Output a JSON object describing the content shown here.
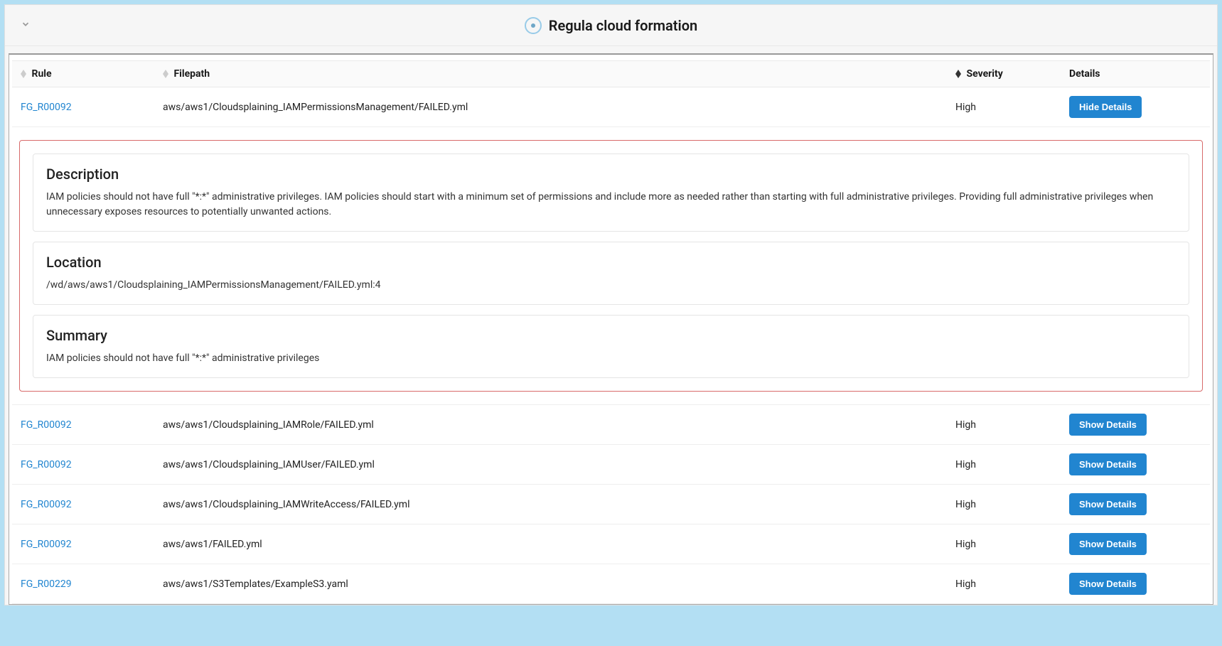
{
  "header": {
    "title": "Regula cloud formation"
  },
  "table": {
    "columns": {
      "rule": "Rule",
      "filepath": "Filepath",
      "severity": "Severity",
      "details": "Details"
    },
    "buttons": {
      "show": "Show Details",
      "hide": "Hide Details"
    },
    "rows": [
      {
        "rule": "FG_R00092",
        "filepath": "aws/aws1/Cloudsplaining_IAMPermissionsManagement/FAILED.yml",
        "severity": "High",
        "expanded": true,
        "details": {
          "description_title": "Description",
          "description_text": "IAM policies should not have full \"*:*\" administrative privileges. IAM policies should start with a minimum set of permissions and include more as needed rather than starting with full administrative privileges. Providing full administrative privileges when unnecessary exposes resources to potentially unwanted actions.",
          "location_title": "Location",
          "location_text": "/wd/aws/aws1/Cloudsplaining_IAMPermissionsManagement/FAILED.yml:4",
          "summary_title": "Summary",
          "summary_text": "IAM policies should not have full \"*:*\" administrative privileges"
        }
      },
      {
        "rule": "FG_R00092",
        "filepath": "aws/aws1/Cloudsplaining_IAMRole/FAILED.yml",
        "severity": "High",
        "expanded": false
      },
      {
        "rule": "FG_R00092",
        "filepath": "aws/aws1/Cloudsplaining_IAMUser/FAILED.yml",
        "severity": "High",
        "expanded": false
      },
      {
        "rule": "FG_R00092",
        "filepath": "aws/aws1/Cloudsplaining_IAMWriteAccess/FAILED.yml",
        "severity": "High",
        "expanded": false
      },
      {
        "rule": "FG_R00092",
        "filepath": "aws/aws1/FAILED.yml",
        "severity": "High",
        "expanded": false
      },
      {
        "rule": "FG_R00229",
        "filepath": "aws/aws1/S3Templates/ExampleS3.yaml",
        "severity": "High",
        "expanded": false
      }
    ]
  }
}
